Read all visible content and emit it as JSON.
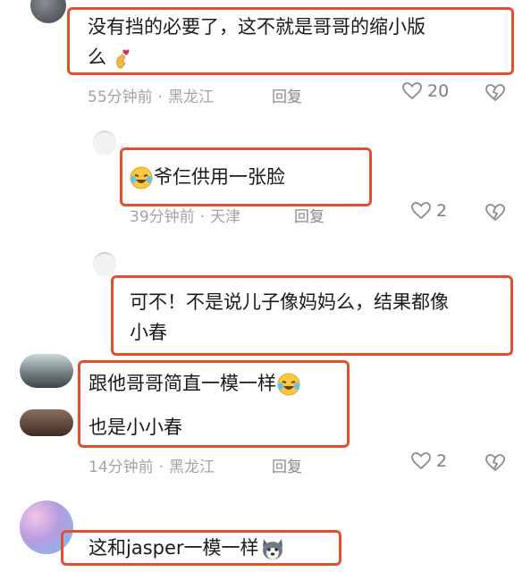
{
  "comments": [
    {
      "text_lines": [
        "没有挡的必要了，这不就是哥哥的缩小版",
        "么"
      ],
      "emoji": "finger-heart-emoji",
      "time": "55分钟前",
      "location": "黑龙江",
      "reply_label": "回复",
      "likes": "20"
    },
    {
      "text": "爷仨供用一张脸",
      "emoji": "laughing-tears-emoji",
      "time": "39分钟前",
      "location": "天津",
      "reply_label": "回复",
      "likes": "2"
    },
    {
      "text_lines": [
        "可不！不是说儿子像妈妈么，结果都像",
        "小春"
      ]
    },
    {
      "text_line1": "跟他哥哥简直一模一样",
      "emoji": "laughing-tears-emoji",
      "text_line2": "也是小小春",
      "time": "14分钟前",
      "location": "黑龙江",
      "reply_label": "回复",
      "likes": "2"
    },
    {
      "text": "这和jasper一模一样",
      "emoji": "husky-dog-emoji"
    }
  ],
  "separator": "·",
  "colors": {
    "highlight": "#e4502f",
    "meta": "#a3a3a3"
  }
}
